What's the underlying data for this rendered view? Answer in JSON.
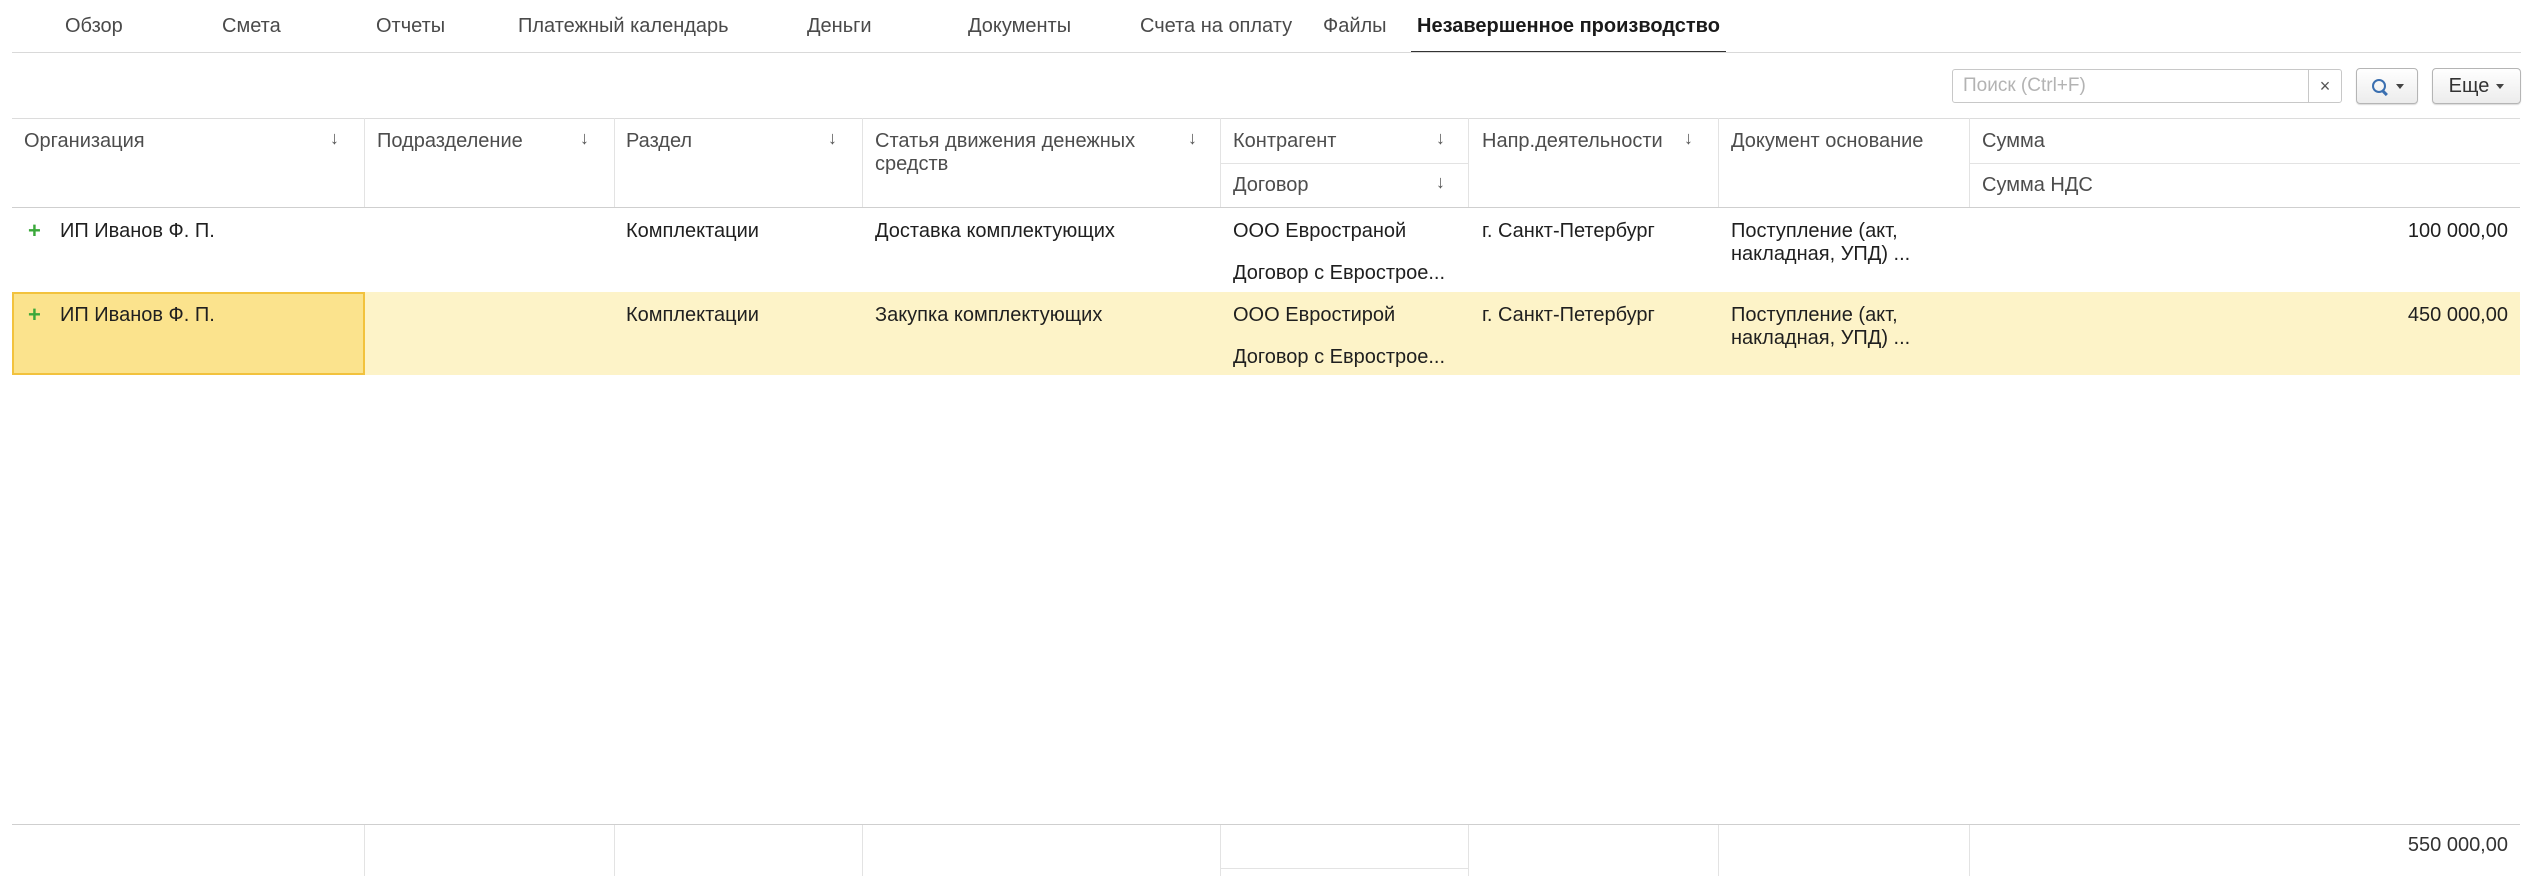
{
  "tabs": [
    {
      "label": "Обзор"
    },
    {
      "label": "Смета"
    },
    {
      "label": "Отчеты"
    },
    {
      "label": "Платежный календарь"
    },
    {
      "label": "Деньги"
    },
    {
      "label": "Документы"
    },
    {
      "label": "Счета на оплату"
    },
    {
      "label": "Файлы"
    },
    {
      "label": "Незавершенное производство",
      "active": true
    }
  ],
  "toolbar": {
    "search_placeholder": "Поиск (Ctrl+F)",
    "search_value": "",
    "clear_label": "×",
    "more_label": "Еще"
  },
  "columns": {
    "organization": "Организация",
    "division": "Подразделение",
    "section": "Раздел",
    "cashflow_item": "Статья движения денежных средств",
    "counterparty": "Контрагент",
    "contract": "Договор",
    "activity": "Напр.деятельности",
    "base_document": "Документ основание",
    "amount": "Сумма",
    "vat_amount": "Сумма НДС",
    "sort_arrow": "↓"
  },
  "rows": [
    {
      "organization": "ИП Иванов Ф. П.",
      "division": "",
      "section": "Комплектации",
      "cashflow_item": "Доставка комплектующих",
      "counterparty": "ООО Евространой",
      "contract": "Договор с Еврострое...",
      "activity": "г. Санкт-Петербург",
      "base_document": "Поступление (акт, накладная, УПД) ...",
      "amount": "100 000,00",
      "selected": false
    },
    {
      "organization": "ИП Иванов Ф. П.",
      "division": "",
      "section": "Комплектации",
      "cashflow_item": "Закупка комплектующих",
      "counterparty": "ООО Евростирой",
      "contract": "Договор с Еврострое...",
      "activity": "г. Санкт-Петербург",
      "base_document": "Поступление (акт, накладная, УПД) ...",
      "amount": "450 000,00",
      "selected": true
    }
  ],
  "footer": {
    "total_amount": "550 000,00"
  },
  "colors": {
    "selected_row": "#fdf3c8",
    "selected_cell": "#fbe38d",
    "selected_border": "#f2c23d",
    "plus_icon": "#3aa83a"
  }
}
